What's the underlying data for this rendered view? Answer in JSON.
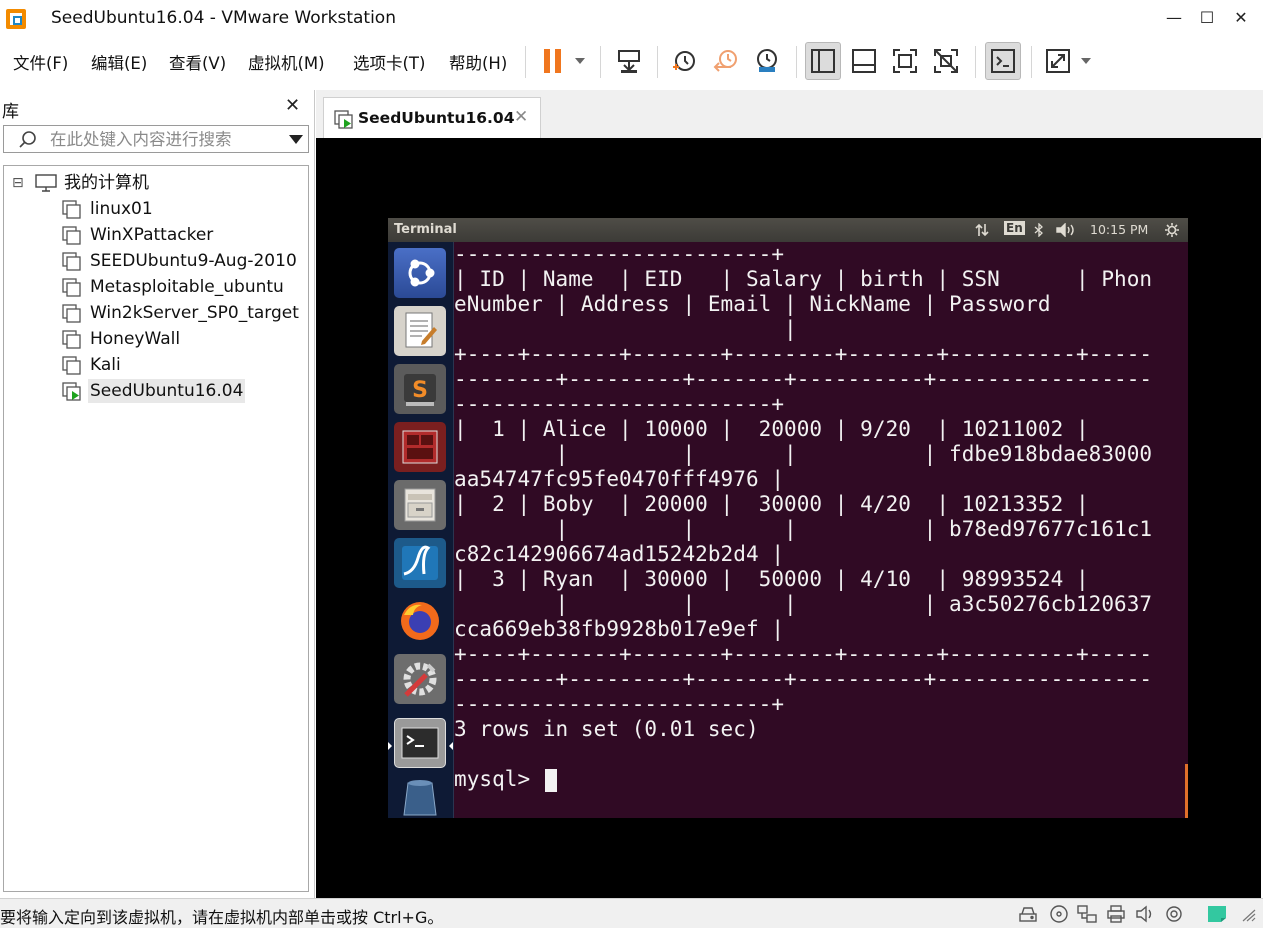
{
  "window": {
    "title": "SeedUbuntu16.04 - VMware Workstation",
    "minimize_glyph": "—",
    "maximize_glyph": "☐",
    "close_glyph": "✕"
  },
  "menu": {
    "items": [
      "文件(F)",
      "编辑(E)",
      "查看(V)",
      "虚拟机(M)",
      "选项卡(T)",
      "帮助(H)"
    ]
  },
  "toolbar": {
    "icons": [
      "pause-icon",
      "send-keys-icon",
      "snapshot-take-icon",
      "snapshot-revert-icon",
      "snapshot-manager-icon",
      "library-view-icon",
      "thumbnail-view-icon",
      "fullscreen-icon",
      "unity-icon",
      "console-view-icon",
      "stretch-icon"
    ],
    "accent": "#f0761e"
  },
  "library": {
    "title": "库",
    "close_glyph": "✕",
    "search_placeholder": "在此处键入内容进行搜索",
    "root": "我的计算机",
    "root_toggle": "⊟",
    "vms": [
      "linux01",
      "WinXPattacker",
      "SEEDUbuntu9-Aug-2010",
      "Metasploitable_ubuntu",
      "Win2kServer_SP0_target",
      "HoneyWall",
      "Kali",
      "SeedUbuntu16.04"
    ],
    "selected": "SeedUbuntu16.04"
  },
  "tabs": {
    "active": "SeedUbuntu16.04",
    "close_glyph": "✕"
  },
  "guest": {
    "topbar_title": "Terminal",
    "keyboard_layout": "En",
    "clock": "10:15 PM",
    "launcher_icons": [
      "ubuntu-dash-icon",
      "text-editor-icon",
      "sublime-text-icon",
      "terminal-app-icon",
      "file-manager-icon",
      "wireshark-icon",
      "firefox-icon",
      "system-settings-icon",
      "terminal-active-icon",
      "trash-icon"
    ]
  },
  "terminal": {
    "lines": [
      "-------------------------+",
      "| ID | Name  | EID   | Salary | birth | SSN      | Phon",
      "eNumber | Address | Email | NickName | Password",
      "                          |",
      "+----+-------+-------+--------+-------+----------+-----",
      "--------+---------+-------+----------+-----------------",
      "-------------------------+",
      "|  1 | Alice | 10000 |  20000 | 9/20  | 10211002 |",
      "        |         |       |          | fdbe918bdae83000",
      "aa54747fc95fe0470fff4976 |",
      "|  2 | Boby  | 20000 |  30000 | 4/20  | 10213352 |",
      "        |         |       |          | b78ed97677c161c1",
      "c82c142906674ad15242b2d4 |",
      "|  3 | Ryan  | 30000 |  50000 | 4/10  | 98993524 |",
      "        |         |       |          | a3c50276cb120637",
      "cca669eb38fb9928b017e9ef |",
      "+----+-------+-------+--------+-------+----------+-----",
      "--------+---------+-------+----------+-----------------",
      "-------------------------+",
      "3 rows in set (0.01 sec)",
      "",
      "mysql> "
    ],
    "background": "#300a24"
  },
  "status": {
    "text": "要将输入定向到该虚拟机，请在虚拟机内部单击或按 Ctrl+G。",
    "icons": [
      "hdd-icon",
      "cd-icon",
      "network-icon",
      "printer-icon",
      "sound-icon",
      "usb-icon",
      "message-icon"
    ]
  }
}
